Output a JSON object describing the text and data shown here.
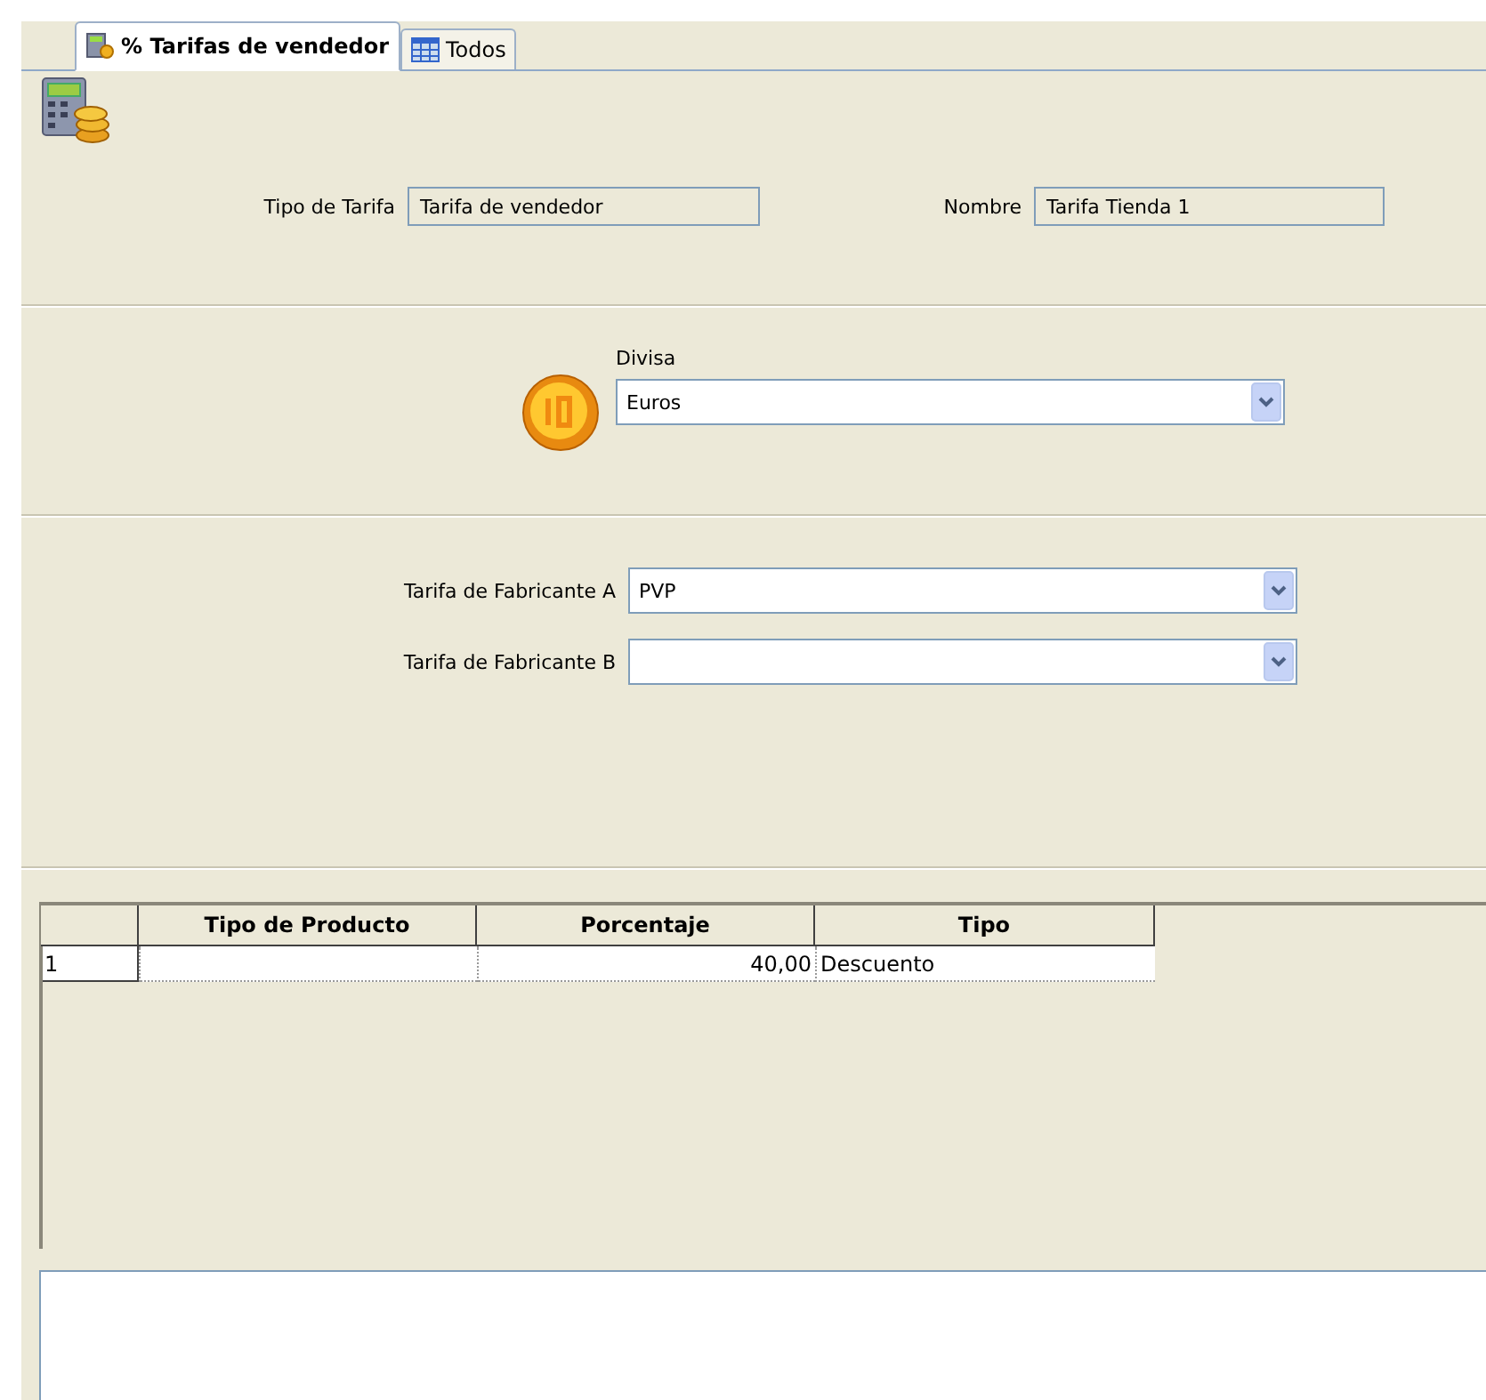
{
  "tabs": [
    {
      "label": "% Tarifas de vendedor",
      "kind": "calculator",
      "selected": true
    },
    {
      "label": "Todos",
      "kind": "grid",
      "selected": false
    }
  ],
  "header": {
    "fields": [
      {
        "label": "Tipo de Tarifa",
        "value": "Tarifa de vendedor"
      },
      {
        "label": "Nombre",
        "value": "Tarifa Tienda 1"
      }
    ]
  },
  "currency": {
    "label": "Divisa",
    "value": "Euros"
  },
  "manufacturer_rates": [
    {
      "label": "Tarifa de Fabricante A",
      "value": "PVP"
    },
    {
      "label": "Tarifa de Fabricante B"
    }
  ],
  "table": {
    "columns": [
      "Tipo de Producto",
      "Porcentaje",
      "Tipo"
    ],
    "rows": [
      {
        "number": "1",
        "cells": [
          "",
          "40,00",
          "Descuento"
        ]
      }
    ]
  }
}
